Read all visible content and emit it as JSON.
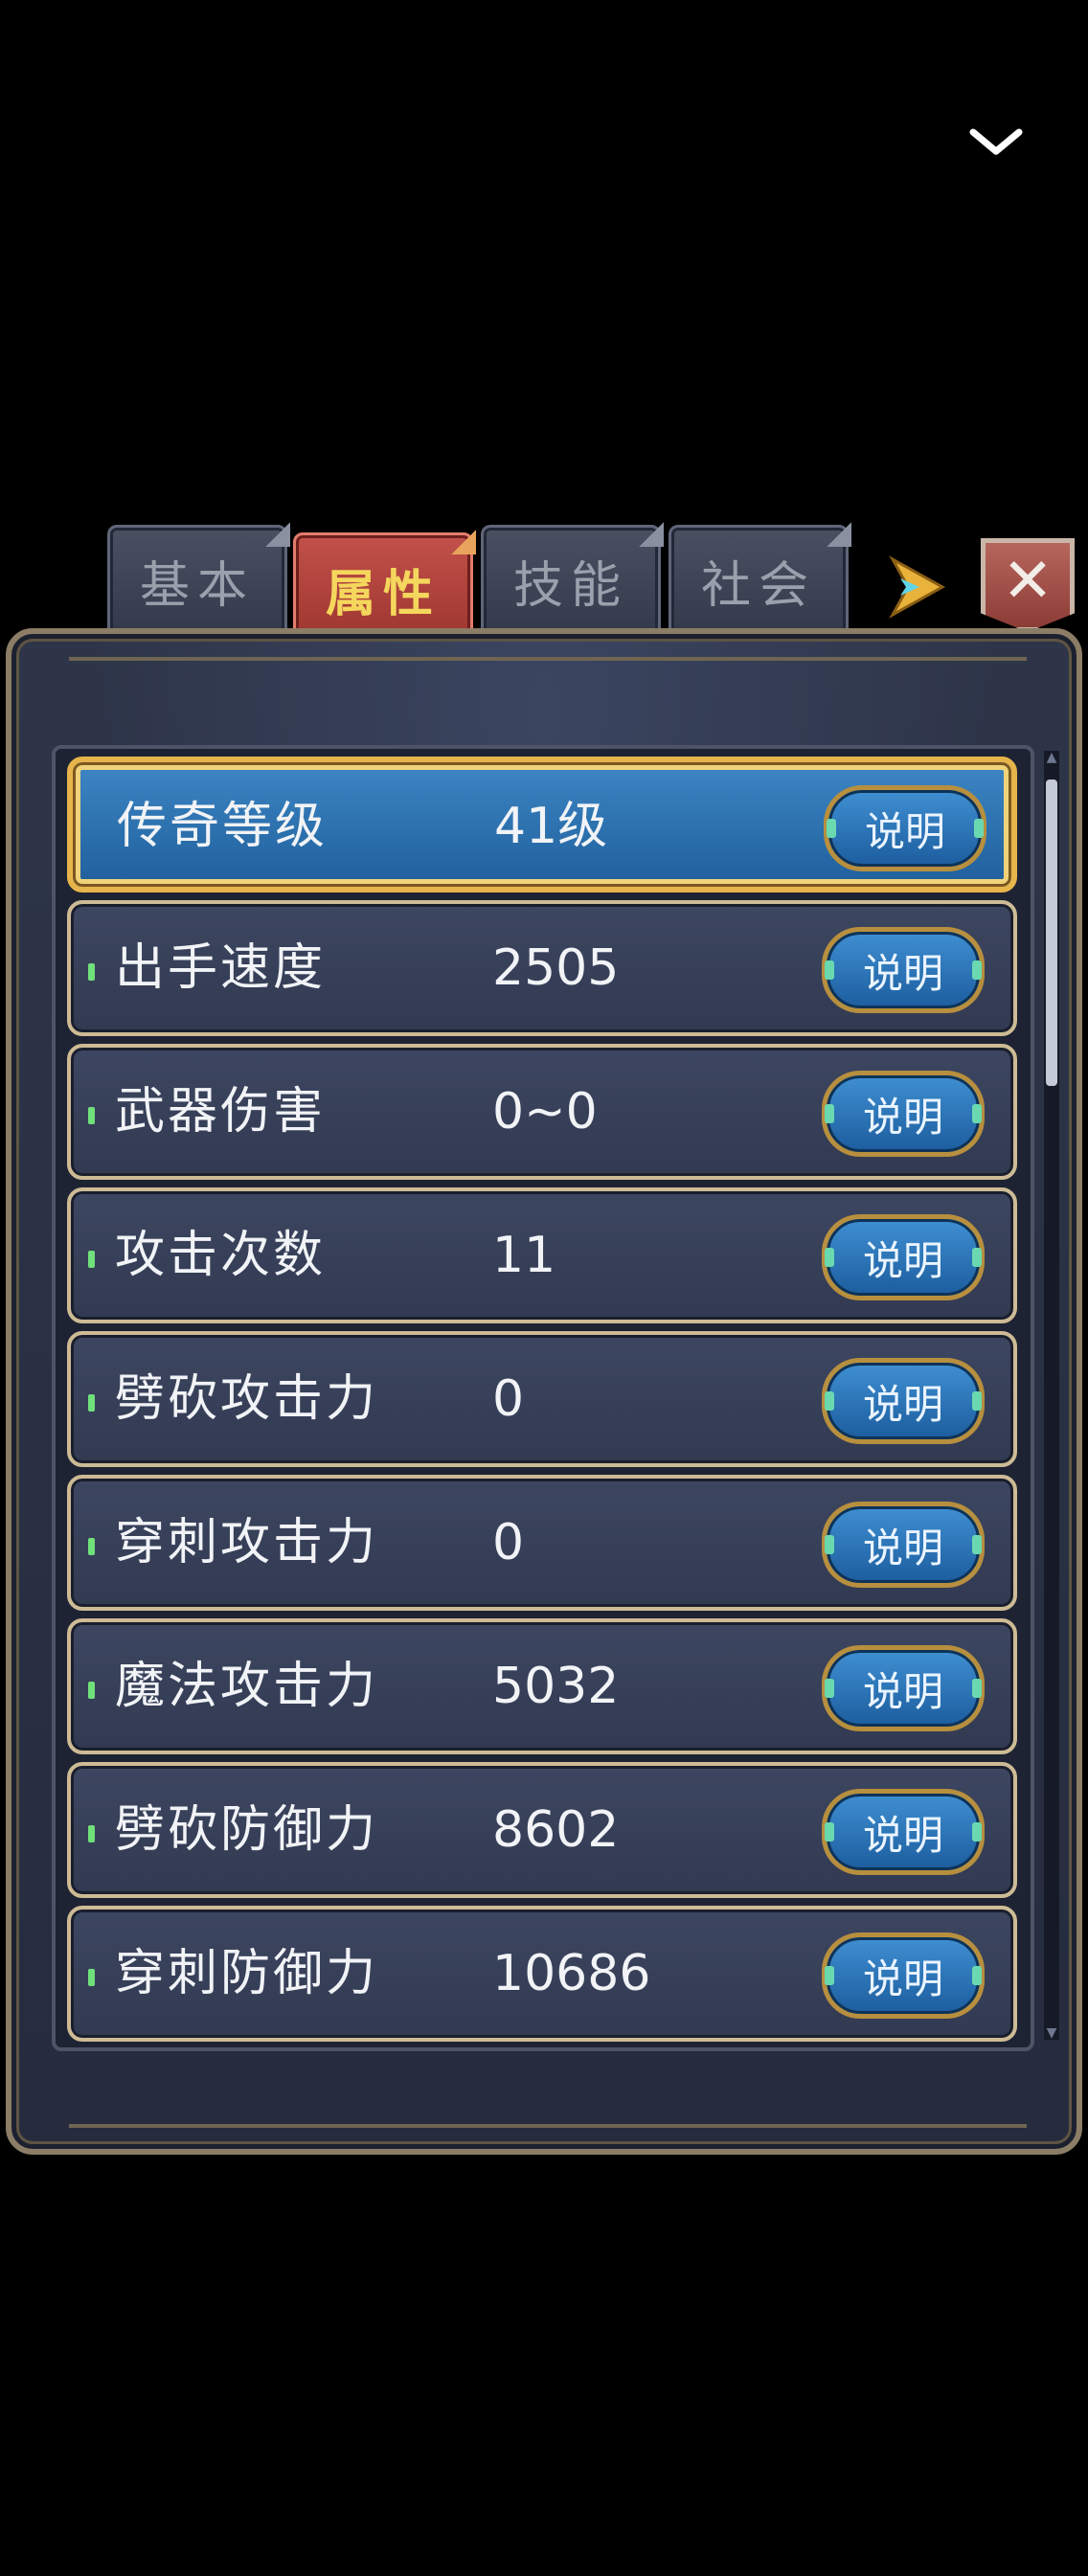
{
  "tabs": [
    {
      "label": "基本",
      "active": false
    },
    {
      "label": "属性",
      "active": true
    },
    {
      "label": "技能",
      "active": false
    },
    {
      "label": "社会",
      "active": false
    }
  ],
  "icons": {
    "collapse": "chevron-down-icon",
    "next_tab": "arrow-right-icon",
    "close": "close-icon"
  },
  "close_symbol": "✕",
  "rows": [
    {
      "label": "传奇等级",
      "value": "41级",
      "button": "说明",
      "selected": true
    },
    {
      "label": "出手速度",
      "value": "2505",
      "button": "说明",
      "selected": false
    },
    {
      "label": "武器伤害",
      "value": "0~0",
      "button": "说明",
      "selected": false
    },
    {
      "label": "攻击次数",
      "value": "11",
      "button": "说明",
      "selected": false
    },
    {
      "label": "劈砍攻击力",
      "value": "0",
      "button": "说明",
      "selected": false
    },
    {
      "label": "穿刺攻击力",
      "value": "0",
      "button": "说明",
      "selected": false
    },
    {
      "label": "魔法攻击力",
      "value": "5032",
      "button": "说明",
      "selected": false
    },
    {
      "label": "劈砍防御力",
      "value": "8602",
      "button": "说明",
      "selected": false
    },
    {
      "label": "穿刺防御力",
      "value": "10686",
      "button": "说明",
      "selected": false
    }
  ],
  "colors": {
    "active_tab": "#b4443e",
    "active_tab_text": "#f4d75c",
    "selected_row": "#2a72b4",
    "row_border": "#cdbb95",
    "info_button": "#2e78bc"
  }
}
